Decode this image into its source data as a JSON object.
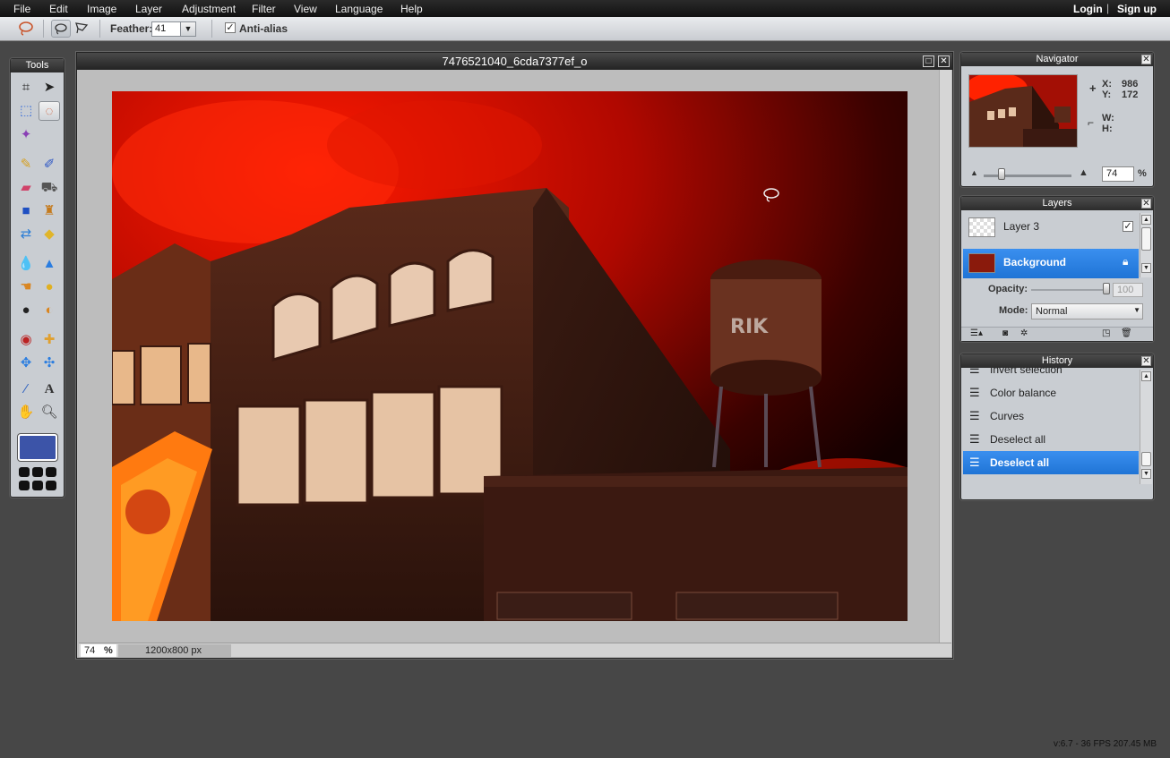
{
  "menubar": {
    "items": [
      "File",
      "Edit",
      "Image",
      "Layer",
      "Adjustment",
      "Filter",
      "View",
      "Language",
      "Help"
    ],
    "login": "Login",
    "separator": "|",
    "signup": "Sign up"
  },
  "options": {
    "feather_label": "Feather:",
    "feather_value": "41",
    "antialias_label": "Anti-alias",
    "antialias_checked": true
  },
  "tools": {
    "title": "Tools",
    "foreground_color": "#3c54a8"
  },
  "document": {
    "title": "7476521040_6cda7377ef_o",
    "zoom": "74",
    "zoom_unit": "%",
    "size": "1200x800 px"
  },
  "navigator": {
    "title": "Navigator",
    "x_label": "X:",
    "x_value": "986",
    "y_label": "Y:",
    "y_value": "172",
    "w_label": "W:",
    "h_label": "H:",
    "zoom": "74",
    "zoom_unit": "%"
  },
  "layers": {
    "title": "Layers",
    "items": [
      {
        "name": "Layer 3",
        "visible": true
      },
      {
        "name": "Background",
        "locked": true
      }
    ],
    "opacity_label": "Opacity:",
    "opacity_value": "100",
    "mode_label": "Mode:",
    "mode_value": "Normal"
  },
  "history": {
    "title": "History",
    "items": [
      "Invert selection",
      "Color balance",
      "Curves",
      "Deselect all",
      "Deselect all"
    ]
  },
  "status": {
    "version": "v:6.7 - 36 FPS 207.45 MB"
  }
}
